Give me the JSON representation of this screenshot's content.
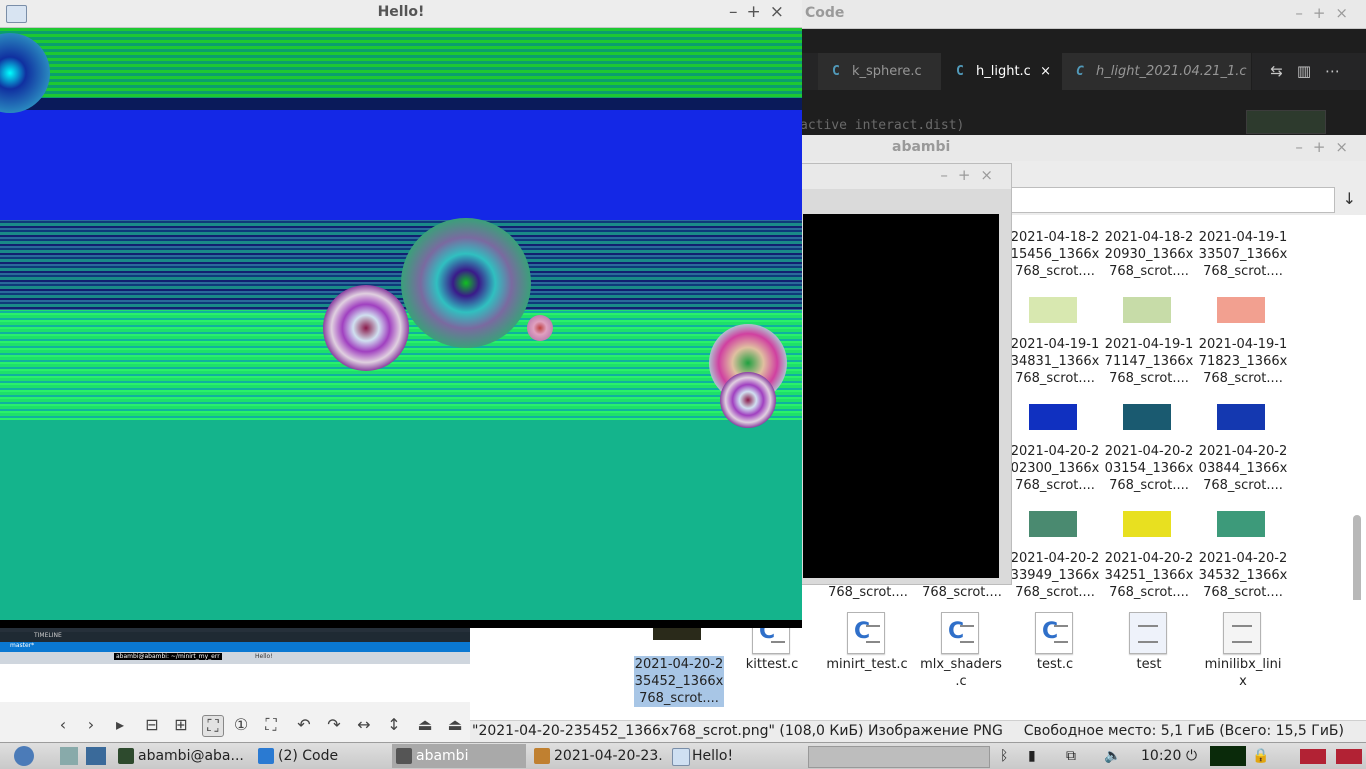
{
  "vscode": {
    "title": "Code",
    "tabs": [
      {
        "label": "k_sphere.c",
        "icon": "C"
      },
      {
        "label": "h_light.c",
        "icon": "C",
        "close": "×"
      },
      {
        "label": "h_light_2021.04.21_1.c",
        "icon": "C"
      }
    ],
    "code_fragment": "active interact.dist)"
  },
  "file_manager": {
    "title": "abambi",
    "items": [
      {
        "name": "2021-04-18-2\n15456_1366x\n768_scrot...."
      },
      {
        "name": "2021-04-18-2\n20930_1366x\n768_scrot...."
      },
      {
        "name": "2021-04-19-1\n33507_1366x\n768_scrot...."
      },
      {
        "name": "2021-04-19-1\n34831_1366x\n768_scrot...."
      },
      {
        "name": "2021-04-19-1\n71147_1366x\n768_scrot...."
      },
      {
        "name": "2021-04-19-1\n71823_1366x\n768_scrot...."
      },
      {
        "name": "2021-04-20-2\n02300_1366x\n768_scrot...."
      },
      {
        "name": "2021-04-20-2\n03154_1366x\n768_scrot...."
      },
      {
        "name": "2021-04-20-2\n03844_1366x\n768_scrot...."
      },
      {
        "name": "2021-04-20-2\n33949_1366x\n768_scrot...."
      },
      {
        "name": "2021-04-20-2\n34251_1366x\n768_scrot...."
      },
      {
        "name": "2021-04-20-2\n34532_1366x\n768_scrot...."
      }
    ],
    "partial_captions": [
      "768_scrot....",
      "768_scrot...."
    ],
    "bottom_files": [
      {
        "name": "2021-04-20-2\n35452_1366x\n768_scrot....",
        "selected": true
      },
      {
        "name": "kittest.c"
      },
      {
        "name": "minirt_test.c"
      },
      {
        "name": "mlx_shaders\n.c"
      },
      {
        "name": "test.c"
      },
      {
        "name": "test"
      },
      {
        "name": "minilibx_lini\nx"
      }
    ],
    "status_left": "\"2021-04-20-235452_1366x768_scrot.png\" (108,0 КиБ) Изображение PNG",
    "status_right": "Свободное место: 5,1 ГиБ (Всего: 15,5 ГиБ)"
  },
  "hello_window": {
    "title": "Hello!"
  },
  "viewer_strip": {
    "timeline": "TIMELINE",
    "branch": "master*",
    "terminal_title": "abambi@abambi: ~/minirt_my_err",
    "hello": "Hello!"
  },
  "taskbar": {
    "tasks": [
      {
        "label": "abambi@aba...",
        "icon": "terminal-icon"
      },
      {
        "label": "(2) Code",
        "icon": "vscode-icon"
      },
      {
        "label": "abambi",
        "icon": "folder-icon",
        "active": true
      },
      {
        "label": "2021-04-20-23...",
        "icon": "image-icon"
      },
      {
        "label": "Hello!",
        "icon": "window-icon"
      }
    ],
    "clock": "10:20"
  },
  "colors": {
    "accent_blue": "#1428e6",
    "teal_floor": "#14b48c",
    "green_sky": "#00ff30"
  }
}
